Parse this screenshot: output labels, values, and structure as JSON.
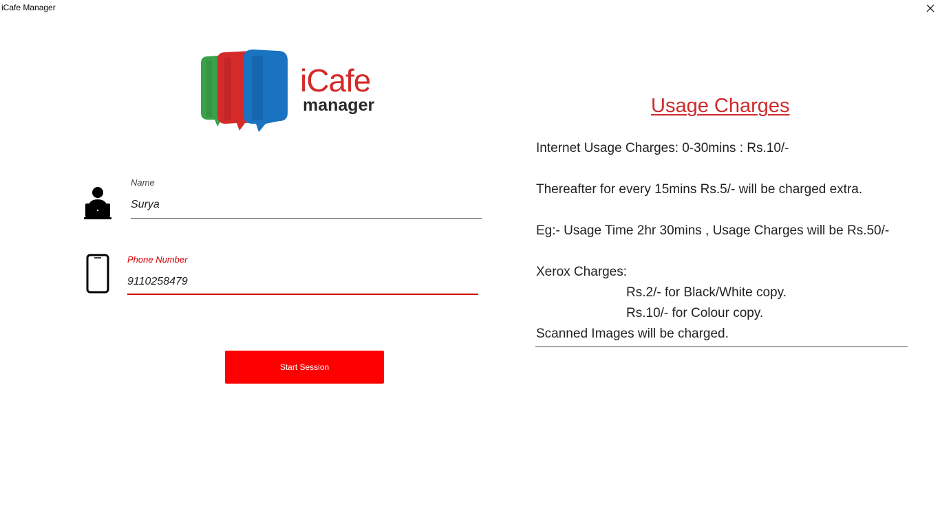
{
  "window": {
    "title": "iCafe Manager",
    "close_icon": "close-icon"
  },
  "logo": {
    "text_main": "iCafe",
    "text_sub": "manager",
    "colors": [
      "#3aa04a",
      "#d42a2a",
      "#1a73c0"
    ]
  },
  "form": {
    "name": {
      "label": "Name",
      "value": "Surya",
      "icon": "user-at-laptop-icon"
    },
    "phone": {
      "label": "Phone Number",
      "value": "9110258479",
      "icon": "mobile-phone-icon",
      "state": "error"
    },
    "start_button_label": "Start Session"
  },
  "usage": {
    "title": "Usage Charges",
    "lines": [
      "Internet Usage Charges:  0-30mins : Rs.10/-",
      "Thereafter for every 15mins Rs.5/- will be charged extra.",
      "Eg:- Usage Time 2hr 30mins , Usage Charges will be Rs.50/-",
      "Xerox Charges:",
      "Rs.2/-  for Black/White copy.",
      "Rs.10/- for Colour copy.",
      "Scanned Images will be charged."
    ]
  },
  "colors": {
    "accent": "#ff0000",
    "error": "#d20000",
    "title": "#cf2a2a"
  }
}
